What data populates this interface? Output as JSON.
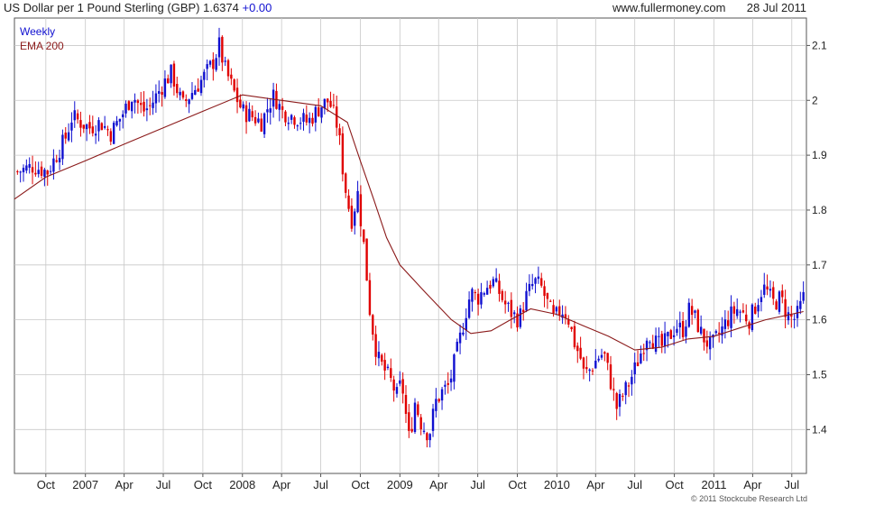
{
  "header": {
    "instrument": "US Dollar per 1 Pound Sterling (GBP)",
    "price": "1.6374",
    "change": "+0.00",
    "site": "www.fullermoney.com",
    "date": "28 Jul 2011"
  },
  "footer": {
    "credit": "© 2011 Stockcube Research Ltd"
  },
  "colors": {
    "up": "#1010d0",
    "down": "#e00000",
    "ema": "#8b1a1a",
    "grid": "#c8c8c8"
  },
  "chart_data": {
    "type": "candlestick",
    "frequency": "Weekly",
    "legend": [
      {
        "label": "Weekly",
        "color": "#1010d0"
      },
      {
        "label": "EMA 200",
        "color": "#8b1a1a"
      }
    ],
    "ylim": [
      1.32,
      2.15
    ],
    "yticks": [
      1.4,
      1.5,
      1.6,
      1.7,
      1.8,
      1.9,
      2.0,
      2.1
    ],
    "ytick_labels": [
      "1.4",
      "1.5",
      "1.6",
      "1.7",
      "1.8",
      "1.9",
      "2",
      "2.1"
    ],
    "xlim": [
      "2006-07-20",
      "2011-08-04"
    ],
    "xticks": [
      {
        "date": "2006-10-01",
        "label": "Oct"
      },
      {
        "date": "2007-01-01",
        "label": "2007"
      },
      {
        "date": "2007-04-01",
        "label": "Apr"
      },
      {
        "date": "2007-07-01",
        "label": "Jul"
      },
      {
        "date": "2007-10-01",
        "label": "Oct"
      },
      {
        "date": "2008-01-01",
        "label": "2008"
      },
      {
        "date": "2008-04-01",
        "label": "Apr"
      },
      {
        "date": "2008-07-01",
        "label": "Jul"
      },
      {
        "date": "2008-10-01",
        "label": "Oct"
      },
      {
        "date": "2009-01-01",
        "label": "2009"
      },
      {
        "date": "2009-04-01",
        "label": "Apr"
      },
      {
        "date": "2009-07-01",
        "label": "Jul"
      },
      {
        "date": "2009-10-01",
        "label": "Oct"
      },
      {
        "date": "2010-01-01",
        "label": "2010"
      },
      {
        "date": "2010-04-01",
        "label": "Apr"
      },
      {
        "date": "2010-07-01",
        "label": "Jul"
      },
      {
        "date": "2010-10-01",
        "label": "Oct"
      },
      {
        "date": "2011-01-01",
        "label": "2011"
      },
      {
        "date": "2011-04-01",
        "label": "Apr"
      },
      {
        "date": "2011-07-01",
        "label": "Jul"
      }
    ],
    "close_path": [
      [
        "2006-07-27",
        1.87
      ],
      [
        "2006-09-01",
        1.88
      ],
      [
        "2006-10-05",
        1.87
      ],
      [
        "2006-11-15",
        1.93
      ],
      [
        "2006-12-01",
        1.97
      ],
      [
        "2007-01-10",
        1.95
      ],
      [
        "2007-02-05",
        1.96
      ],
      [
        "2007-03-01",
        1.94
      ],
      [
        "2007-04-01",
        1.98
      ],
      [
        "2007-04-20",
        2.01
      ],
      [
        "2007-05-15",
        1.98
      ],
      [
        "2007-06-01",
        1.99
      ],
      [
        "2007-07-01",
        2.03
      ],
      [
        "2007-07-20",
        2.05
      ],
      [
        "2007-08-15",
        1.99
      ],
      [
        "2007-09-01",
        2.01
      ],
      [
        "2007-10-01",
        2.04
      ],
      [
        "2007-10-25",
        2.07
      ],
      [
        "2007-11-08",
        2.1
      ],
      [
        "2007-11-20",
        2.06
      ],
      [
        "2007-12-15",
        2.01
      ],
      [
        "2008-01-01",
        1.98
      ],
      [
        "2008-01-25",
        1.97
      ],
      [
        "2008-02-15",
        1.96
      ],
      [
        "2008-03-01",
        1.99
      ],
      [
        "2008-03-15",
        2.01
      ],
      [
        "2008-04-01",
        1.98
      ],
      [
        "2008-05-01",
        1.97
      ],
      [
        "2008-06-01",
        1.96
      ],
      [
        "2008-07-01",
        1.99
      ],
      [
        "2008-07-20",
        2.0
      ],
      [
        "2008-08-10",
        1.95
      ],
      [
        "2008-08-25",
        1.85
      ],
      [
        "2008-09-10",
        1.78
      ],
      [
        "2008-09-25",
        1.83
      ],
      [
        "2008-10-10",
        1.73
      ],
      [
        "2008-10-24",
        1.61
      ],
      [
        "2008-11-10",
        1.53
      ],
      [
        "2008-11-25",
        1.51
      ],
      [
        "2008-12-10",
        1.49
      ],
      [
        "2008-12-26",
        1.46
      ],
      [
        "2009-01-05",
        1.49
      ],
      [
        "2009-01-16",
        1.42
      ],
      [
        "2009-01-23",
        1.38
      ],
      [
        "2009-02-05",
        1.45
      ],
      [
        "2009-02-20",
        1.41
      ],
      [
        "2009-03-10",
        1.39
      ],
      [
        "2009-03-25",
        1.45
      ],
      [
        "2009-04-10",
        1.47
      ],
      [
        "2009-04-25",
        1.48
      ],
      [
        "2009-05-10",
        1.53
      ],
      [
        "2009-05-25",
        1.58
      ],
      [
        "2009-06-05",
        1.62
      ],
      [
        "2009-06-15",
        1.65
      ],
      [
        "2009-07-01",
        1.64
      ],
      [
        "2009-07-20",
        1.66
      ],
      [
        "2009-08-05",
        1.67
      ],
      [
        "2009-08-20",
        1.65
      ],
      [
        "2009-09-01",
        1.63
      ],
      [
        "2009-09-20",
        1.61
      ],
      [
        "2009-10-05",
        1.6
      ],
      [
        "2009-10-20",
        1.64
      ],
      [
        "2009-11-10",
        1.67
      ],
      [
        "2009-11-25",
        1.66
      ],
      [
        "2009-12-10",
        1.63
      ],
      [
        "2009-12-25",
        1.6
      ],
      [
        "2010-01-10",
        1.62
      ],
      [
        "2010-01-25",
        1.61
      ],
      [
        "2010-02-10",
        1.56
      ],
      [
        "2010-02-25",
        1.53
      ],
      [
        "2010-03-05",
        1.5
      ],
      [
        "2010-03-20",
        1.51
      ],
      [
        "2010-04-05",
        1.53
      ],
      [
        "2010-04-20",
        1.54
      ],
      [
        "2010-05-05",
        1.49
      ],
      [
        "2010-05-20",
        1.44
      ],
      [
        "2010-06-01",
        1.46
      ],
      [
        "2010-06-15",
        1.48
      ],
      [
        "2010-07-01",
        1.51
      ],
      [
        "2010-07-15",
        1.54
      ],
      [
        "2010-08-01",
        1.58
      ],
      [
        "2010-08-15",
        1.56
      ],
      [
        "2010-09-01",
        1.55
      ],
      [
        "2010-09-20",
        1.57
      ],
      [
        "2010-10-05",
        1.59
      ],
      [
        "2010-10-20",
        1.58
      ],
      [
        "2010-11-05",
        1.62
      ],
      [
        "2010-11-20",
        1.6
      ],
      [
        "2010-12-05",
        1.57
      ],
      [
        "2010-12-25",
        1.55
      ],
      [
        "2011-01-10",
        1.57
      ],
      [
        "2011-01-25",
        1.59
      ],
      [
        "2011-02-10",
        1.61
      ],
      [
        "2011-02-25",
        1.62
      ],
      [
        "2011-03-10",
        1.61
      ],
      [
        "2011-03-25",
        1.6
      ],
      [
        "2011-04-10",
        1.63
      ],
      [
        "2011-04-25",
        1.66
      ],
      [
        "2011-05-05",
        1.65
      ],
      [
        "2011-05-20",
        1.63
      ],
      [
        "2011-06-05",
        1.64
      ],
      [
        "2011-06-20",
        1.61
      ],
      [
        "2011-07-05",
        1.6
      ],
      [
        "2011-07-15",
        1.61
      ],
      [
        "2011-07-28",
        1.64
      ]
    ],
    "ema_200": [
      [
        "2006-07-20",
        1.82
      ],
      [
        "2006-10-01",
        1.86
      ],
      [
        "2007-01-01",
        1.89
      ],
      [
        "2007-04-01",
        1.92
      ],
      [
        "2007-07-01",
        1.95
      ],
      [
        "2007-10-01",
        1.98
      ],
      [
        "2008-01-01",
        2.01
      ],
      [
        "2008-04-01",
        2.0
      ],
      [
        "2008-07-01",
        1.99
      ],
      [
        "2008-09-01",
        1.96
      ],
      [
        "2008-10-01",
        1.89
      ],
      [
        "2008-11-01",
        1.82
      ],
      [
        "2008-12-01",
        1.75
      ],
      [
        "2009-01-01",
        1.7
      ],
      [
        "2009-03-01",
        1.65
      ],
      [
        "2009-05-01",
        1.6
      ],
      [
        "2009-06-15",
        1.575
      ],
      [
        "2009-08-01",
        1.58
      ],
      [
        "2009-09-15",
        1.6
      ],
      [
        "2009-11-01",
        1.62
      ],
      [
        "2010-01-01",
        1.61
      ],
      [
        "2010-03-01",
        1.59
      ],
      [
        "2010-05-01",
        1.57
      ],
      [
        "2010-07-01",
        1.545
      ],
      [
        "2010-09-01",
        1.55
      ],
      [
        "2010-11-01",
        1.565
      ],
      [
        "2011-01-01",
        1.57
      ],
      [
        "2011-03-01",
        1.585
      ],
      [
        "2011-05-01",
        1.6
      ],
      [
        "2011-07-28",
        1.615
      ]
    ]
  }
}
